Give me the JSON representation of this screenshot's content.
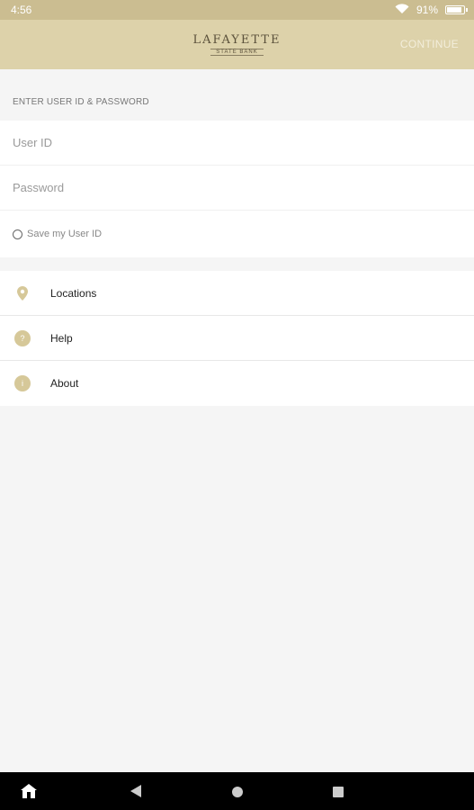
{
  "status_bar": {
    "time": "4:56",
    "battery": "91%",
    "battery_level": 0.91
  },
  "app_bar": {
    "logo_main": "LAFAYETTE",
    "logo_sub": "STATE BANK",
    "continue_label": "CONTINUE"
  },
  "login": {
    "section_title": "ENTER USER ID & PASSWORD",
    "user_id_placeholder": "User ID",
    "password_placeholder": "Password",
    "save_label": "Save my User ID"
  },
  "menu": {
    "items": [
      {
        "label": "Locations",
        "icon": "location-pin-icon"
      },
      {
        "label": "Help",
        "icon": "help-icon",
        "glyph": "?"
      },
      {
        "label": "About",
        "icon": "info-icon",
        "glyph": "i"
      }
    ]
  },
  "colors": {
    "accent": "#ddd2aa",
    "status_bar": "#cbbd91",
    "icon": "#d6c899"
  }
}
